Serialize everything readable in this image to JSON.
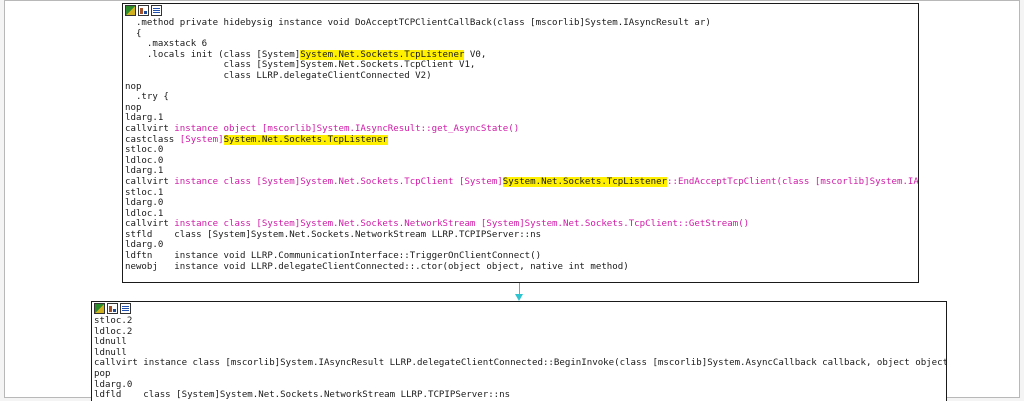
{
  "colors": {
    "keyword_pink": "#d01aa8",
    "highlight": "#ffef00",
    "edge": "#2ec4d0"
  },
  "toolbar_icons": [
    "color-icon",
    "graph-icon",
    "text-view-icon"
  ],
  "node1": {
    "lines": [
      [
        {
          "t": "  .method private hidebysig instance void DoAcceptTCPClientCallBack(class [mscorlib]System.IAsyncResult ar)"
        }
      ],
      [
        {
          "t": "  {"
        }
      ],
      [
        {
          "t": "    .maxstack 6"
        }
      ],
      [
        {
          "t": "    .locals init (class [System]"
        },
        {
          "t": "System.Net.Sockets.TcpListener",
          "c": "hl"
        },
        {
          "t": " V0,"
        }
      ],
      [
        {
          "t": "                  class [System]System.Net.Sockets.TcpClient V1,"
        }
      ],
      [
        {
          "t": "                  class LLRP.delegateClientConnected V2)"
        }
      ],
      [
        {
          "t": "nop"
        }
      ],
      [
        {
          "t": "  .try {"
        }
      ],
      [
        {
          "t": "nop"
        }
      ],
      [
        {
          "t": "ldarg.1"
        }
      ],
      [
        {
          "t": "callvirt "
        },
        {
          "t": "instance object [mscorlib]System.IAsyncResult::get_AsyncState()",
          "c": "pink"
        }
      ],
      [
        {
          "t": "castclass "
        },
        {
          "t": "[System]",
          "c": "pink"
        },
        {
          "t": "System.Net.Sockets.TcpListener",
          "c": "hl"
        }
      ],
      [
        {
          "t": "stloc.0"
        }
      ],
      [
        {
          "t": "ldloc.0"
        }
      ],
      [
        {
          "t": "ldarg.1"
        }
      ],
      [
        {
          "t": "callvirt "
        },
        {
          "t": "instance class [System]System.Net.Sockets.TcpClient [System]",
          "c": "pink"
        },
        {
          "t": "System.Net.Sockets.TcpListener",
          "c": "hl"
        },
        {
          "t": "::EndAcceptTcpClient(class [mscorlib]System.IAsyncResult)",
          "c": "pink"
        }
      ],
      [
        {
          "t": "stloc.1"
        }
      ],
      [
        {
          "t": "ldarg.0"
        }
      ],
      [
        {
          "t": "ldloc.1"
        }
      ],
      [
        {
          "t": "callvirt "
        },
        {
          "t": "instance class [System]System.Net.Sockets.NetworkStream [System]System.Net.Sockets.TcpClient::GetStream()",
          "c": "pink"
        }
      ],
      [
        {
          "t": "stfld    class [System]System.Net.Sockets.NetworkStream LLRP.TCPIPServer::ns"
        }
      ],
      [
        {
          "t": "ldarg.0"
        }
      ],
      [
        {
          "t": "ldftn    instance void LLRP.CommunicationInterface::TriggerOnClientConnect()"
        }
      ],
      [
        {
          "t": "newobj   instance void LLRP.delegateClientConnected::.ctor(object object, native int method)"
        }
      ]
    ]
  },
  "node2": {
    "lines": [
      [
        {
          "t": "stloc.2"
        }
      ],
      [
        {
          "t": "ldloc.2"
        }
      ],
      [
        {
          "t": "ldnull"
        }
      ],
      [
        {
          "t": "ldnull"
        }
      ],
      [
        {
          "t": "callvirt instance class [mscorlib]System.IAsyncResult LLRP.delegateClientConnected::BeginInvoke(class [mscorlib]System.AsyncCallback callback, object object)"
        }
      ],
      [
        {
          "t": "pop"
        }
      ],
      [
        {
          "t": "ldarg.0"
        }
      ],
      [
        {
          "t": "ldfld    class [System]System.Net.Sockets.NetworkStream LLRP.TCPIPServer::ns"
        }
      ]
    ]
  }
}
